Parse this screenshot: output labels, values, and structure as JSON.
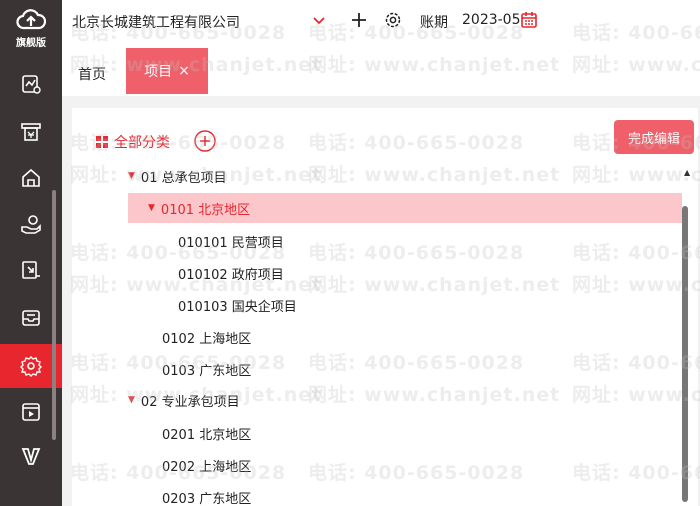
{
  "sidebar": {
    "logo_text": "旗舰版",
    "items": [
      {
        "icon": "report-icon"
      },
      {
        "icon": "invoice-icon"
      },
      {
        "icon": "home-icon"
      },
      {
        "icon": "hand-coin-icon"
      },
      {
        "icon": "document-export-icon"
      },
      {
        "icon": "tray-icon"
      },
      {
        "icon": "gear-icon",
        "active": true
      },
      {
        "icon": "video-icon"
      },
      {
        "icon": "v-logo-icon"
      }
    ],
    "active_color": "#e8262e"
  },
  "topbar": {
    "company": "北京长城建筑工程有限公司",
    "period_label": "账期",
    "period_value": "2023-05"
  },
  "tabs": [
    {
      "label": "首页"
    },
    {
      "label": "项目",
      "close": "×",
      "active": true
    }
  ],
  "panel": {
    "all_categories": "全部分类",
    "finish_button": "完成编辑",
    "tree": [
      {
        "label": "01 总承包项目",
        "expanded": true,
        "level": 0
      },
      {
        "label": "0101 北京地区",
        "expanded": true,
        "level": 1,
        "selected": true
      },
      {
        "label": "010101 民营项目",
        "level": 2
      },
      {
        "label": "010102 政府项目",
        "level": 2
      },
      {
        "label": "010103 国央企项目",
        "level": 2
      },
      {
        "label": "0102 上海地区",
        "level": 1
      },
      {
        "label": "0103 广东地区",
        "level": 1
      },
      {
        "label": "02 专业承包项目",
        "expanded": true,
        "level": 0
      },
      {
        "label": "0201 北京地区",
        "level": 1
      },
      {
        "label": "0202 上海地区",
        "level": 1
      },
      {
        "label": "0203 广东地区",
        "level": 1
      }
    ]
  },
  "watermark": {
    "phone": "电话: 400-665-0028",
    "site": "网址: www.chanjet.net"
  },
  "colors": {
    "accent": "#e8262e",
    "tab_active": "#f0606a",
    "selected_row": "#fbc7ca",
    "sidebar_bg": "#3b3434"
  }
}
